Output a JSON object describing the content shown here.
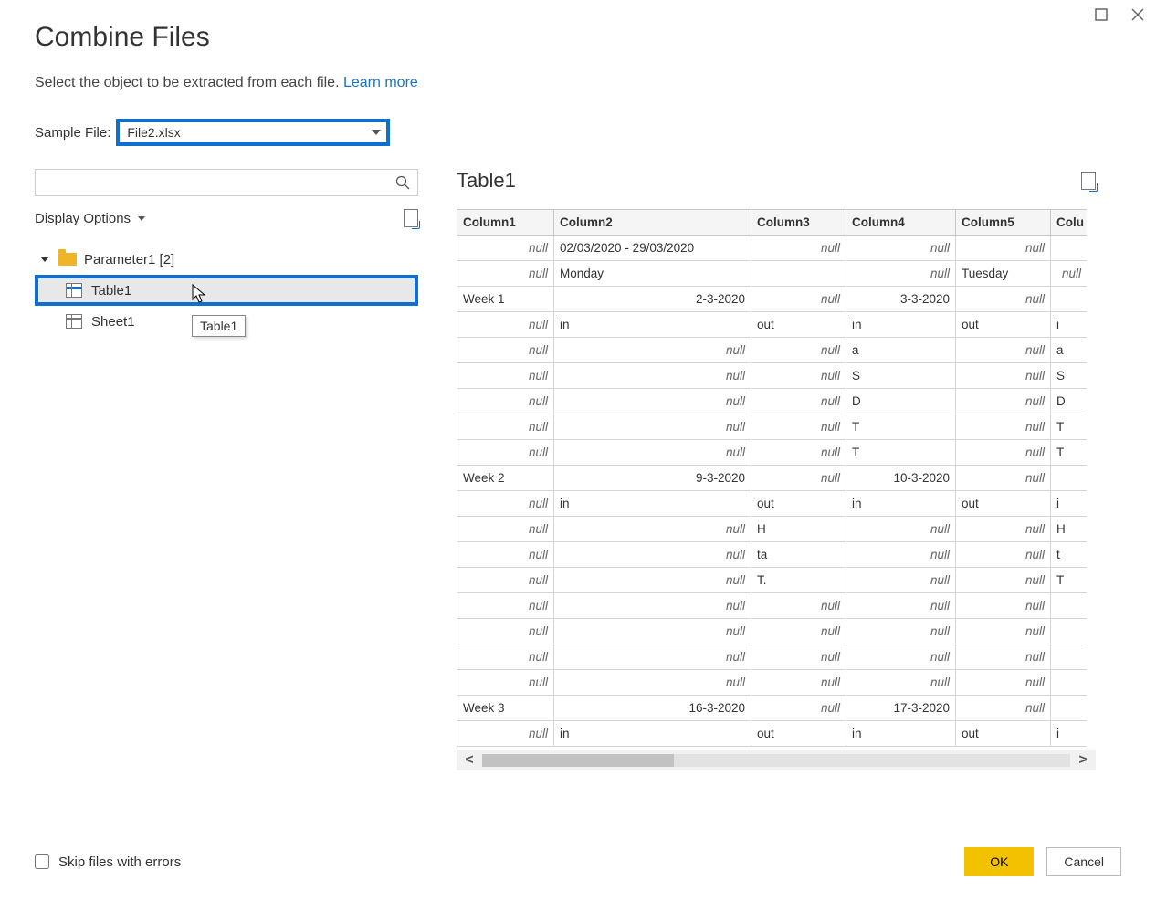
{
  "dialog": {
    "title": "Combine Files",
    "subtitle": "Select the object to be extracted from each file.",
    "learn_more": "Learn more",
    "sample_file_label": "Sample File:",
    "sample_file_value": "File2.xlsx"
  },
  "left_pane": {
    "display_options_label": "Display Options",
    "root_label": "Parameter1 [2]",
    "items": [
      {
        "label": "Table1",
        "kind": "table",
        "selected": true
      },
      {
        "label": "Sheet1",
        "kind": "sheet",
        "selected": false
      }
    ],
    "tooltip": "Table1"
  },
  "right_pane": {
    "title": "Table1",
    "columns": [
      "Column1",
      "Column2",
      "Column3",
      "Column4",
      "Column5",
      "Colu"
    ],
    "rows": [
      [
        null,
        "02/03/2020 - 29/03/2020",
        null,
        null,
        null,
        ""
      ],
      [
        null,
        "Monday",
        "",
        null,
        "Tuesday",
        null
      ],
      [
        "Week 1",
        "2-3-2020",
        null,
        "3-3-2020",
        null,
        ""
      ],
      [
        null,
        "in",
        "out",
        "in",
        "out",
        "i"
      ],
      [
        null,
        null,
        null,
        "a",
        null,
        "a"
      ],
      [
        null,
        null,
        null,
        "S",
        null,
        "S"
      ],
      [
        null,
        null,
        null,
        "D",
        null,
        "D"
      ],
      [
        null,
        null,
        null,
        "T",
        null,
        "T"
      ],
      [
        null,
        null,
        null,
        "T",
        null,
        "T"
      ],
      [
        "Week 2",
        "9-3-2020",
        null,
        "10-3-2020",
        null,
        ""
      ],
      [
        null,
        "in",
        "out",
        "in",
        "out",
        "i"
      ],
      [
        null,
        null,
        "H",
        null,
        null,
        "H"
      ],
      [
        null,
        null,
        "ta",
        null,
        null,
        "t"
      ],
      [
        null,
        null,
        "T.",
        null,
        null,
        "T"
      ],
      [
        null,
        null,
        null,
        null,
        null,
        ""
      ],
      [
        null,
        null,
        null,
        null,
        null,
        ""
      ],
      [
        null,
        null,
        null,
        null,
        null,
        ""
      ],
      [
        null,
        null,
        null,
        null,
        null,
        ""
      ],
      [
        "Week 3",
        "16-3-2020",
        null,
        "17-3-2020",
        null,
        ""
      ],
      [
        null,
        "in",
        "out",
        "in",
        "out",
        "i"
      ]
    ],
    "rnum_cols": {
      "1": [
        2,
        9,
        18
      ],
      "3": [
        2,
        9,
        18
      ]
    }
  },
  "bottom": {
    "skip_label": "Skip files with errors",
    "ok_label": "OK",
    "cancel_label": "Cancel"
  }
}
